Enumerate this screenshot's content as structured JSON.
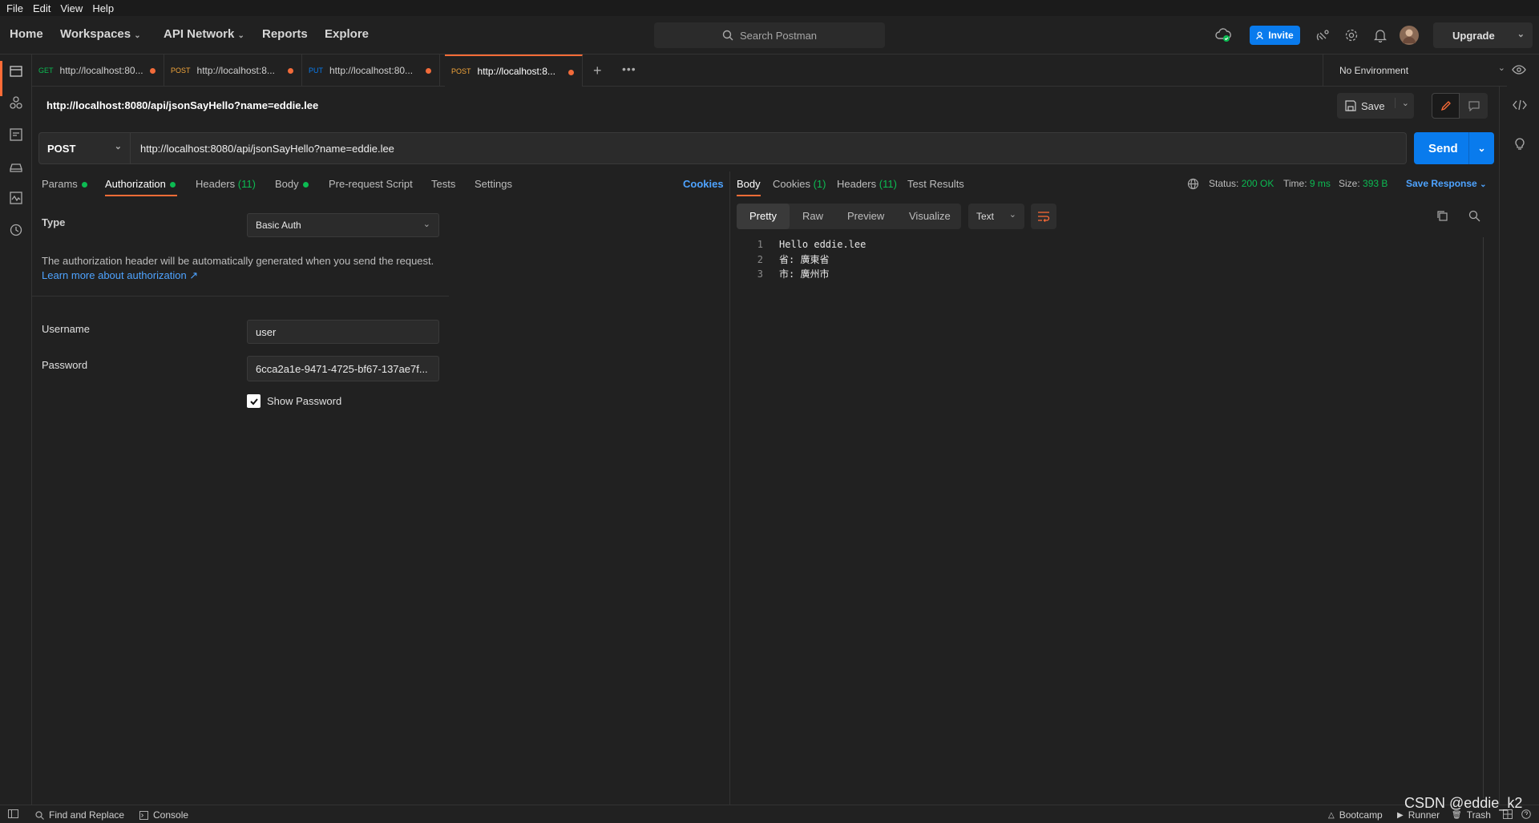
{
  "menubar": [
    "File",
    "Edit",
    "View",
    "Help"
  ],
  "header": {
    "nav": [
      "Home",
      "Workspaces",
      "API Network",
      "Reports",
      "Explore"
    ],
    "search_placeholder": "Search Postman",
    "invite_label": "Invite",
    "upgrade_label": "Upgrade"
  },
  "tabs": [
    {
      "method": "GET",
      "url": "http://localhost:80...",
      "method_color": "#0cbb52"
    },
    {
      "method": "POST",
      "url": "http://localhost:8...",
      "method_color": "#f2a53a"
    },
    {
      "method": "PUT",
      "url": "http://localhost:80...",
      "method_color": "#097bed"
    },
    {
      "method": "POST",
      "url": "http://localhost:8...",
      "method_color": "#f2a53a"
    }
  ],
  "environment": "No Environment",
  "request": {
    "title": "http://localhost:8080/api/jsonSayHello?name=eddie.lee",
    "save_label": "Save",
    "method": "POST",
    "url": "http://localhost:8080/api/jsonSayHello?name=eddie.lee",
    "send_label": "Send",
    "tabs": {
      "params": "Params",
      "authorization": "Authorization",
      "headers": "Headers",
      "headers_count": "(11)",
      "body": "Body",
      "prerequest": "Pre-request Script",
      "tests": "Tests",
      "settings": "Settings"
    },
    "cookies_link": "Cookies"
  },
  "auth": {
    "type_label": "Type",
    "type_value": "Basic Auth",
    "help_text": "The authorization header will be automatically generated when you send the request.",
    "learn_more": "Learn more about authorization ↗",
    "username_label": "Username",
    "username_value": "user",
    "password_label": "Password",
    "password_value": "6cca2a1e-9471-4725-bf67-137ae7f...",
    "show_password_label": "Show Password",
    "show_password_checked": true
  },
  "response": {
    "tabs": {
      "body": "Body",
      "cookies": "Cookies",
      "cookies_count": "(1)",
      "headers": "Headers",
      "headers_count": "(11)",
      "test_results": "Test Results"
    },
    "status_label": "Status:",
    "status_value": "200 OK",
    "time_label": "Time:",
    "time_value": "9 ms",
    "size_label": "Size:",
    "size_value": "393 B",
    "save_response_label": "Save Response",
    "view_tabs": [
      "Pretty",
      "Raw",
      "Preview",
      "Visualize"
    ],
    "format": "Text",
    "lines": [
      {
        "num": "1",
        "text": "Hello eddie.lee"
      },
      {
        "num": "2",
        "text": "省: 廣東省"
      },
      {
        "num": "3",
        "text": "市: 廣州市"
      }
    ]
  },
  "statusbar": {
    "find_replace": "Find and Replace",
    "console": "Console",
    "bootcamp": "Bootcamp",
    "runner": "Runner",
    "trash": "Trash",
    "watermark": "CSDN @eddie_k2"
  },
  "colors": {
    "accent": "#ff6c37",
    "primary": "#097bed",
    "success": "#0cbb52",
    "bg": "#212121"
  }
}
